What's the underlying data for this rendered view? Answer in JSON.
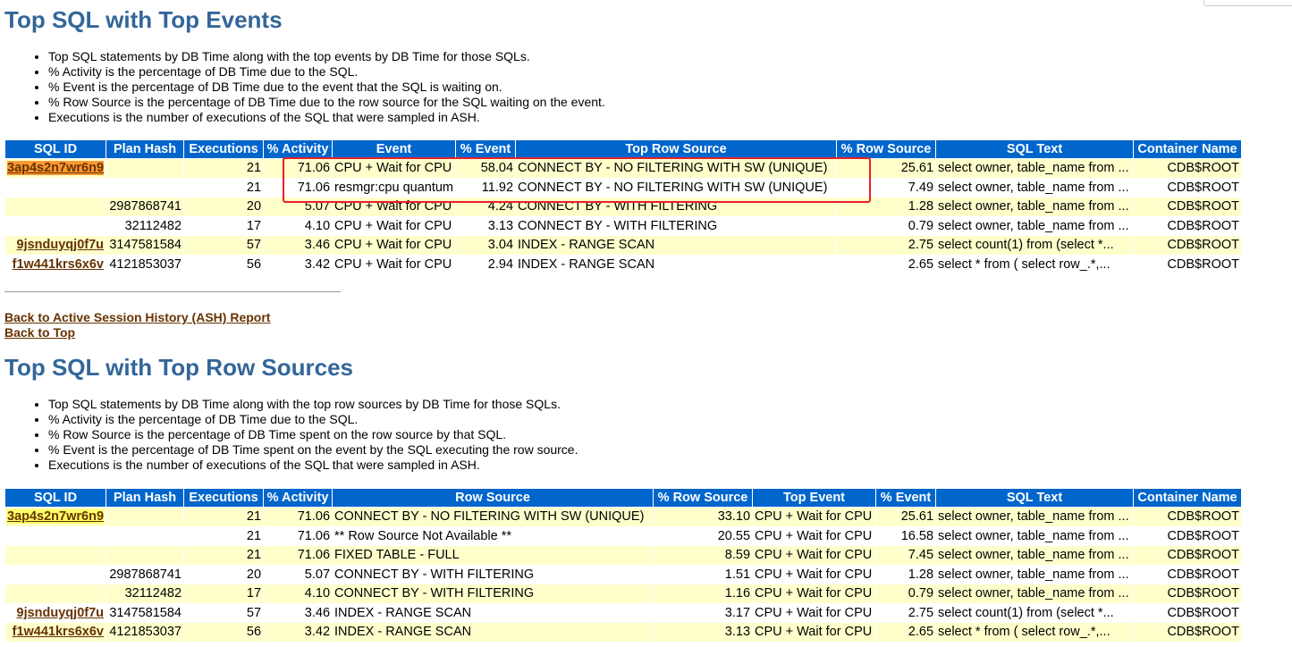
{
  "section1": {
    "title": "Top SQL with Top Events",
    "notes": [
      "Top SQL statements by DB Time along with the top events by DB Time for those SQLs.",
      "% Activity is the percentage of DB Time due to the SQL.",
      "% Event is the percentage of DB Time due to the event that the SQL is waiting on.",
      "% Row Source is the percentage of DB Time due to the row source for the SQL waiting on the event.",
      "Executions is the number of executions of the SQL that were sampled in ASH."
    ],
    "headers": [
      "SQL ID",
      "Plan Hash",
      "Executions",
      "% Activity",
      "Event",
      "% Event",
      "Top Row Source",
      "% Row Source",
      "SQL Text",
      "Container Name"
    ],
    "rows": [
      [
        "3ap4s2n7wr6n9",
        "",
        "21",
        "71.06",
        "CPU + Wait for CPU",
        "58.04",
        "CONNECT BY - NO FILTERING WITH SW (UNIQUE)",
        "25.61",
        "select owner, table_name from ...",
        "CDB$ROOT"
      ],
      [
        "",
        "",
        "21",
        "71.06",
        "resmgr:cpu quantum",
        "11.92",
        "CONNECT BY - NO FILTERING WITH SW (UNIQUE)",
        "7.49",
        "select owner, table_name from ...",
        "CDB$ROOT"
      ],
      [
        "",
        "2987868741",
        "20",
        "5.07",
        "CPU + Wait for CPU",
        "4.24",
        "CONNECT BY - WITH FILTERING",
        "1.28",
        "select owner, table_name from ...",
        "CDB$ROOT"
      ],
      [
        "",
        "32112482",
        "17",
        "4.10",
        "CPU + Wait for CPU",
        "3.13",
        "CONNECT BY - WITH FILTERING",
        "0.79",
        "select owner, table_name from ...",
        "CDB$ROOT"
      ],
      [
        "9jsnduyqj0f7u",
        "3147581584",
        "57",
        "3.46",
        "CPU + Wait for CPU",
        "3.04",
        "INDEX - RANGE SCAN",
        "2.75",
        "select count(1) from (select *...",
        "CDB$ROOT"
      ],
      [
        "f1w441krs6x6v",
        "4121853037",
        "56",
        "3.42",
        "CPU + Wait for CPU",
        "2.94",
        "INDEX - RANGE SCAN",
        "2.65",
        "select * from ( select row_.*,...",
        "CDB$ROOT"
      ]
    ]
  },
  "links": {
    "back_ash": "Back to Active Session History (ASH) Report",
    "back_top": "Back to Top"
  },
  "section2": {
    "title": "Top SQL with Top Row Sources",
    "notes": [
      "Top SQL statements by DB Time along with the top row sources by DB Time for those SQLs.",
      "% Activity is the percentage of DB Time due to the SQL.",
      "% Row Source is the percentage of DB Time spent on the row source by that SQL.",
      "% Event is the percentage of DB Time spent on the event by the SQL executing the row source.",
      "Executions is the number of executions of the SQL that were sampled in ASH."
    ],
    "headers": [
      "SQL ID",
      "Plan Hash",
      "Executions",
      "% Activity",
      "Row Source",
      "% Row Source",
      "Top Event",
      "% Event",
      "SQL Text",
      "Container Name"
    ],
    "rows": [
      [
        "3ap4s2n7wr6n9",
        "",
        "21",
        "71.06",
        "CONNECT BY - NO FILTERING WITH SW (UNIQUE)",
        "33.10",
        "CPU + Wait for CPU",
        "25.61",
        "select owner, table_name from ...",
        "CDB$ROOT"
      ],
      [
        "",
        "",
        "21",
        "71.06",
        "** Row Source Not Available **",
        "20.55",
        "CPU + Wait for CPU",
        "16.58",
        "select owner, table_name from ...",
        "CDB$ROOT"
      ],
      [
        "",
        "",
        "21",
        "71.06",
        "FIXED TABLE - FULL",
        "8.59",
        "CPU + Wait for CPU",
        "7.45",
        "select owner, table_name from ...",
        "CDB$ROOT"
      ],
      [
        "",
        "2987868741",
        "20",
        "5.07",
        "CONNECT BY - WITH FILTERING",
        "1.51",
        "CPU + Wait for CPU",
        "1.28",
        "select owner, table_name from ...",
        "CDB$ROOT"
      ],
      [
        "",
        "32112482",
        "17",
        "4.10",
        "CONNECT BY - WITH FILTERING",
        "1.16",
        "CPU + Wait for CPU",
        "0.79",
        "select owner, table_name from ...",
        "CDB$ROOT"
      ],
      [
        "9jsnduyqj0f7u",
        "3147581584",
        "57",
        "3.46",
        "INDEX - RANGE SCAN",
        "3.17",
        "CPU + Wait for CPU",
        "2.75",
        "select count(1) from (select *...",
        "CDB$ROOT"
      ],
      [
        "f1w441krs6x6v",
        "4121853037",
        "56",
        "3.42",
        "INDEX - RANGE SCAN",
        "3.13",
        "CPU + Wait for CPU",
        "2.65",
        "select * from ( select row_.*,...",
        "CDB$ROOT"
      ]
    ]
  }
}
